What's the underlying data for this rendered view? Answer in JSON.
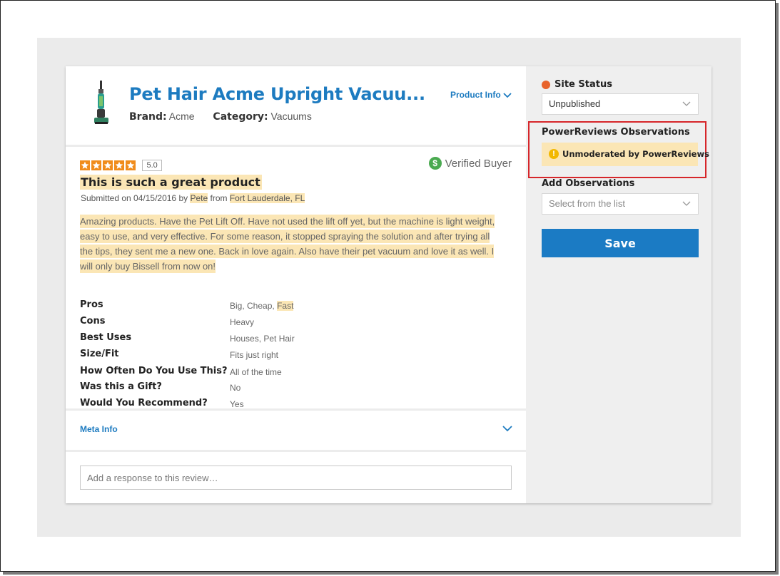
{
  "product": {
    "title": "Pet Hair Acme Upright Vacuu...",
    "brand_label": "Brand:",
    "brand": "Acme",
    "category_label": "Category:",
    "category": "Vacuums",
    "info_link": "Product Info",
    "thumbnail_icon": "vacuum-image"
  },
  "review": {
    "rating": 5,
    "rating_text": "5.0",
    "verified_label": "Verified Buyer",
    "title": "This is such a great product",
    "submitted_prefix": "Submitted on 04/15/2016 by",
    "author": "Pete",
    "from_word": "from",
    "location": "Fort Lauderdale, FL",
    "body_lines": [
      "Amazing products. Have the Pet Lift Off. Have not used the lift off yet, but the machine is light weight,",
      "easy to use, and very effective. For some reason, it stopped spraying the solution and after trying all",
      "the tips, they sent me a new one. Back in love again. Also have their pet vacuum and love it as well. I",
      "will only buy Bissell from now on!"
    ],
    "attributes": [
      {
        "key": "Pros",
        "value": "Big, Cheap,",
        "highlight": "Fast"
      },
      {
        "key": "Cons",
        "value": "Heavy"
      },
      {
        "key": "Best Uses",
        "value": "Houses, Pet Hair"
      },
      {
        "key": "Size/Fit",
        "value": "Fits just right"
      },
      {
        "key": "How Often Do You Use This?",
        "value": "All of the time"
      },
      {
        "key": "Was this a Gift?",
        "value": "No"
      },
      {
        "key": "Would You Recommend?",
        "value": "Yes"
      }
    ]
  },
  "meta_info": {
    "label": "Meta Info"
  },
  "response": {
    "placeholder": "Add a response to this review…"
  },
  "sidebar": {
    "site_status_label": "Site Status",
    "site_status_value": "Unpublished",
    "status_color": "#e8632b",
    "observations_label": "PowerReviews Observations",
    "observation_tag": "Unmoderated by PowerReviews",
    "add_observations_label": "Add Observations",
    "add_observations_placeholder": "Select from the list",
    "save_label": "Save"
  },
  "colors": {
    "accent": "#1d7bc0",
    "highlight": "#fbe6b5",
    "star": "#f08c1c",
    "verified": "#4aaa50",
    "callout_border": "#d6262a",
    "save_button": "#1b7bc4"
  }
}
